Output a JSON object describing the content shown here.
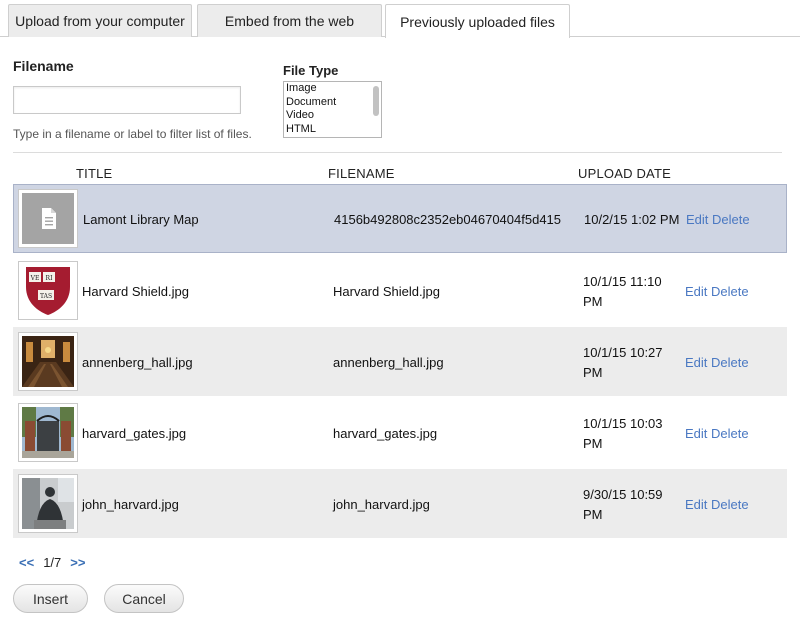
{
  "tabs": [
    {
      "label": "Upload from your computer",
      "active": false
    },
    {
      "label": "Embed from the web",
      "active": false
    },
    {
      "label": "Previously uploaded files",
      "active": true
    }
  ],
  "filters": {
    "filename_label": "Filename",
    "filename_value": "",
    "filename_help": "Type in a filename or label to filter list of files.",
    "filetype_label": "File Type",
    "filetype_options": [
      "Image",
      "Document",
      "Video",
      "HTML"
    ]
  },
  "table": {
    "headers": {
      "title": "TITLE",
      "filename": "FILENAME",
      "upload_date": "UPLOAD DATE"
    },
    "rows": [
      {
        "thumb": "document-icon",
        "title": "Lamont Library Map",
        "filename": "4156b492808c2352eb04670404f5d415",
        "date": "10/2/15 1:02 PM",
        "edit": "Edit",
        "delete": "Delete",
        "selected": true
      },
      {
        "thumb": "harvard-shield-image",
        "title": "Harvard Shield.jpg",
        "filename": "Harvard Shield.jpg",
        "date": "10/1/15 11:10 PM",
        "edit": "Edit",
        "delete": "Delete",
        "shield_text": [
          "VE",
          "RI",
          "TAS"
        ]
      },
      {
        "thumb": "annenberg-hall-photo",
        "title": "annenberg_hall.jpg",
        "filename": "annenberg_hall.jpg",
        "date": "10/1/15 10:27 PM",
        "edit": "Edit",
        "delete": "Delete"
      },
      {
        "thumb": "harvard-gates-photo",
        "title": "harvard_gates.jpg",
        "filename": "harvard_gates.jpg",
        "date": "10/1/15 10:03 PM",
        "edit": "Edit",
        "delete": "Delete"
      },
      {
        "thumb": "john-harvard-statue-photo",
        "title": "john_harvard.jpg",
        "filename": "john_harvard.jpg",
        "date": "9/30/15 10:59 PM",
        "edit": "Edit",
        "delete": "Delete"
      }
    ]
  },
  "pager": {
    "prev": "<<",
    "page": "1/7",
    "next": ">>"
  },
  "buttons": {
    "insert": "Insert",
    "cancel": "Cancel"
  },
  "colors": {
    "selected_row": "#cfd5e3",
    "stripe_row": "#ececec",
    "link": "#4a78c2",
    "shield_red": "#a51c30"
  }
}
